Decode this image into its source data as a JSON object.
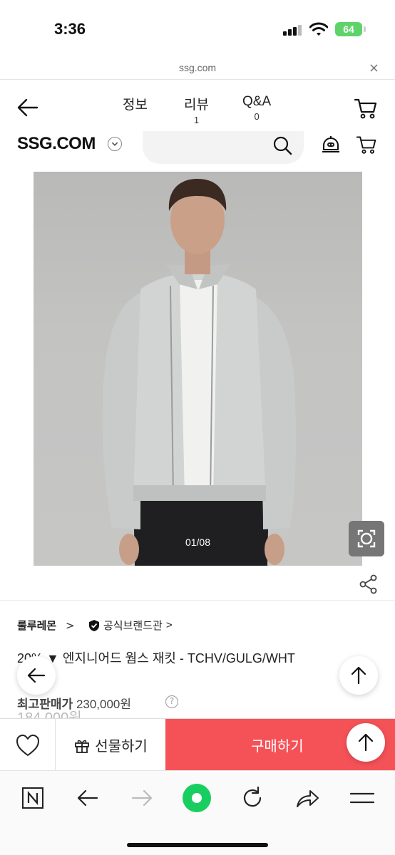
{
  "status_bar": {
    "time": "3:36",
    "battery": "64"
  },
  "url_bar": {
    "url": "ssg.com",
    "close": "×"
  },
  "nav": {
    "tabs": [
      {
        "label": "정보",
        "count": ""
      },
      {
        "label": "리뷰",
        "count": "1"
      },
      {
        "label": "Q&A",
        "count": "0"
      }
    ]
  },
  "brand_row": {
    "logo": "SSG.COM"
  },
  "product": {
    "image_counter": "01/08",
    "brand": "룰루레몬",
    "brand_chevron": ">",
    "official_label": "공식브랜드관",
    "official_chevron": ">",
    "title": "20% ▼ 엔지니어드 웜스 재킷 - TCHV/GULG/WHT",
    "max_price_label": "최고판매가",
    "max_price_value": "230,000원",
    "help_icon": "?",
    "sale_price_partial": "184,000원"
  },
  "action_bar": {
    "gift_label": "선물하기",
    "buy_label": "구매하기",
    "buy_color": "#f55258"
  },
  "icons": {
    "back": "arrow-left-icon",
    "cart": "cart-icon",
    "search": "search-icon",
    "chatbot": "chatbot-icon",
    "lens": "image-search-icon",
    "share": "share-icon",
    "heart": "heart-icon",
    "gift": "gift-icon",
    "up": "arrow-up-icon"
  }
}
